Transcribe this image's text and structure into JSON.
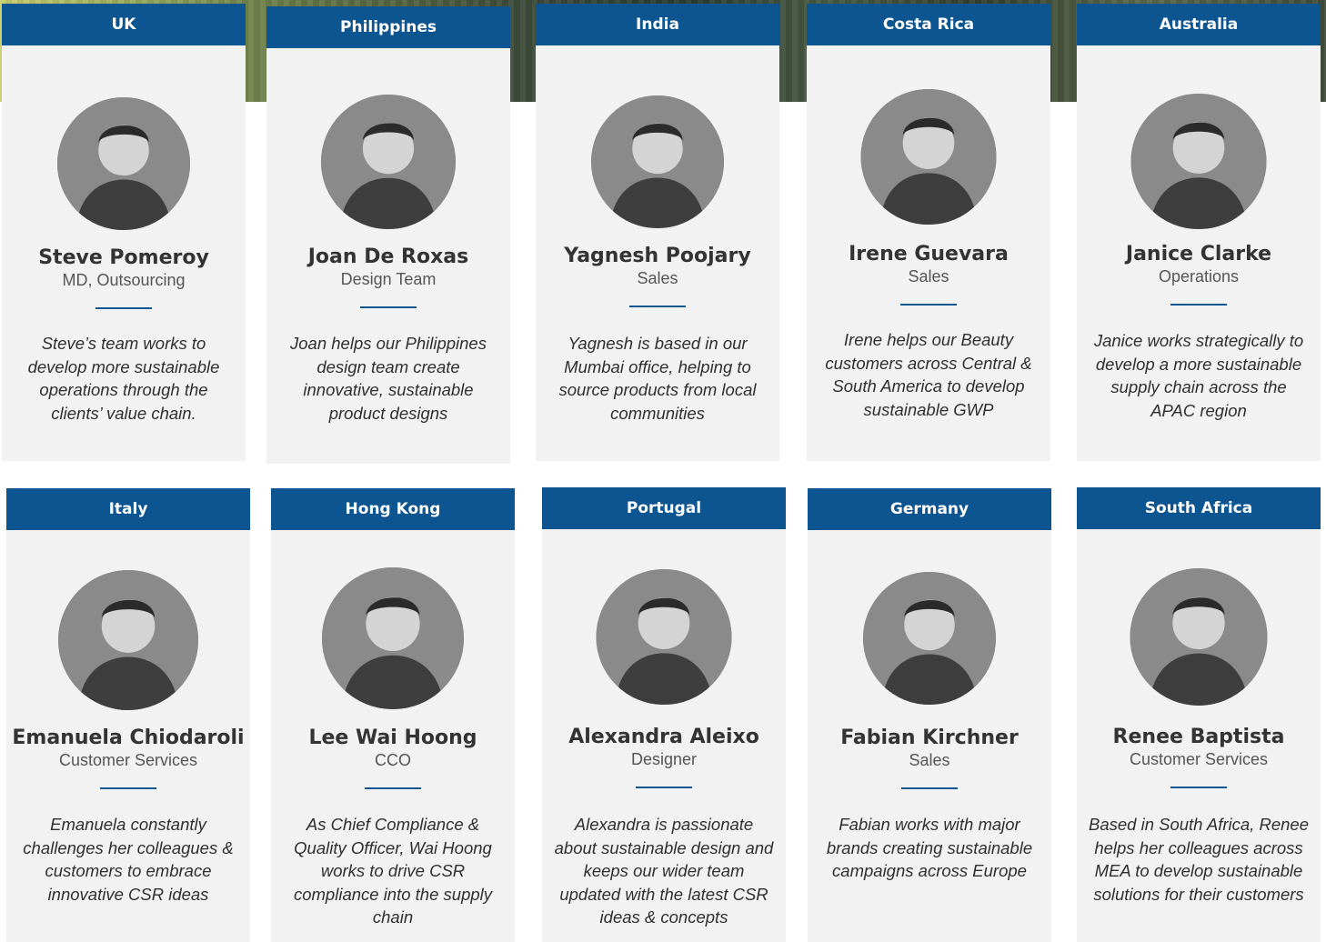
{
  "cards": [
    {
      "country": "UK",
      "name": "Steve Pomeroy",
      "role": "MD, Outsourcing",
      "bio": "Steve’s team works to develop more sustainable operations through the clients’ value chain.",
      "photo_icon": "person-photo-icon"
    },
    {
      "country": "Philippines",
      "name": "Joan De Roxas",
      "role": "Design Team",
      "bio": "Joan helps our Philippines design team create innovative, sustainable product designs",
      "photo_icon": "person-photo-icon"
    },
    {
      "country": "India",
      "name": "Yagnesh Poojary",
      "role": "Sales",
      "bio": "Yagnesh is based in our Mumbai office, helping to source products from local communities",
      "photo_icon": "person-photo-icon"
    },
    {
      "country": "Costa Rica",
      "name": "Irene Guevara",
      "role": "Sales",
      "bio": "Irene helps our Beauty customers across Central & South America to develop sustainable GWP",
      "photo_icon": "person-photo-icon"
    },
    {
      "country": "Australia",
      "name": "Janice Clarke",
      "role": "Operations",
      "bio": "Janice works strategically to develop a more sustainable supply chain across the APAC region",
      "photo_icon": "person-photo-icon"
    },
    {
      "country": "Italy",
      "name": "Emanuela Chiodaroli",
      "role": "Customer Services",
      "bio": "Emanuela constantly challenges her colleagues & customers to embrace innovative CSR ideas",
      "photo_icon": "person-photo-icon"
    },
    {
      "country": "Hong Kong",
      "name": "Lee Wai Hoong",
      "role": "CCO",
      "bio": "As Chief Compliance & Quality Officer, Wai Hoong works to drive CSR compliance into the supply chain",
      "photo_icon": "person-photo-icon"
    },
    {
      "country": "Portugal",
      "name": "Alexandra Aleixo",
      "role": "Designer",
      "bio": "Alexandra is passionate about sustainable design and keeps our wider team updated with the latest CSR ideas & concepts",
      "photo_icon": "person-photo-icon"
    },
    {
      "country": "Germany",
      "name": "Fabian Kirchner",
      "role": "Sales",
      "bio": "Fabian works with major brands creating sustainable campaigns across Europe",
      "photo_icon": "person-photo-icon"
    },
    {
      "country": "South Africa",
      "name": "Renee Baptista",
      "role": "Customer Services",
      "bio": "Based in South Africa, Renee helps her colleagues across MEA to develop sustainable solutions for their customers",
      "photo_icon": "person-photo-icon"
    }
  ],
  "colors": {
    "header_blue": "#0d5590",
    "card_background": "#f2f2f2",
    "divider_blue": "#0d5590"
  }
}
